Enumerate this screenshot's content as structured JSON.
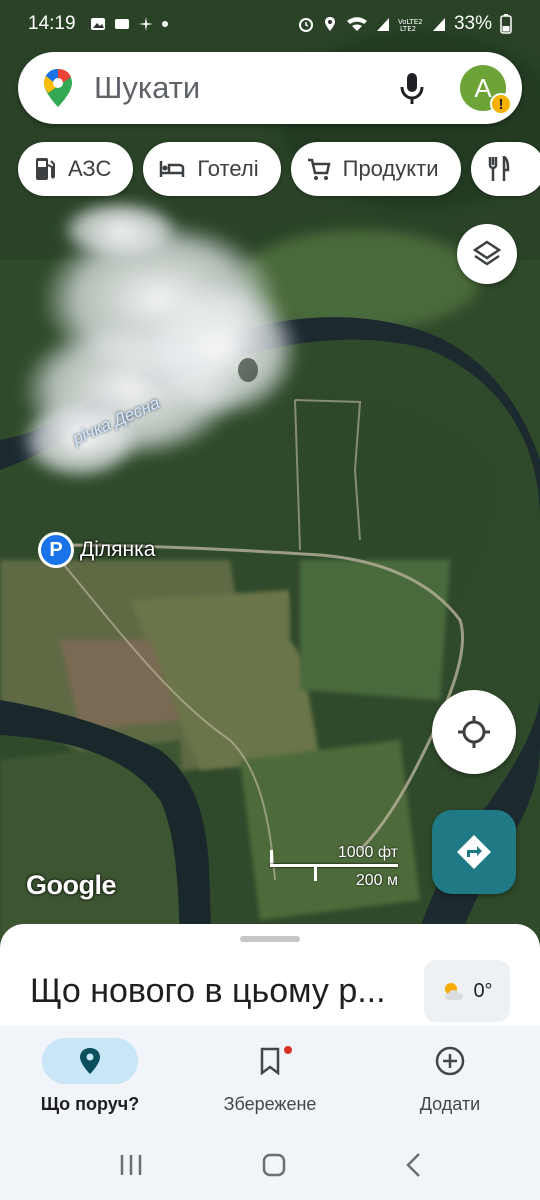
{
  "status_bar": {
    "time": "14:19",
    "battery": "33%"
  },
  "search": {
    "placeholder": "Шукати",
    "avatar_letter": "A"
  },
  "chips": [
    {
      "label": "АЗС",
      "icon": "gas-station-icon"
    },
    {
      "label": "Готелі",
      "icon": "hotel-bed-icon"
    },
    {
      "label": "Продукти",
      "icon": "shopping-cart-icon"
    },
    {
      "label": "",
      "icon": "restaurant-icon"
    }
  ],
  "map": {
    "river_label": "річка Десна",
    "place_label": "Ділянка",
    "place_marker": "P",
    "scale_feet": "1000 фт",
    "scale_meters": "200 м",
    "attribution": "Google"
  },
  "sheet": {
    "title": "Що нового в цьому р...",
    "weather": "0°"
  },
  "nav": [
    {
      "label": "Що поруч?",
      "icon": "location-pin-icon",
      "active": true
    },
    {
      "label": "Збережене",
      "icon": "bookmark-icon",
      "active": false
    },
    {
      "label": "Додати",
      "icon": "add-circle-icon",
      "active": false
    }
  ],
  "colors": {
    "accent": "#1f7a86",
    "active_pill": "#c8e6f5",
    "avatar": "#6ea338"
  }
}
